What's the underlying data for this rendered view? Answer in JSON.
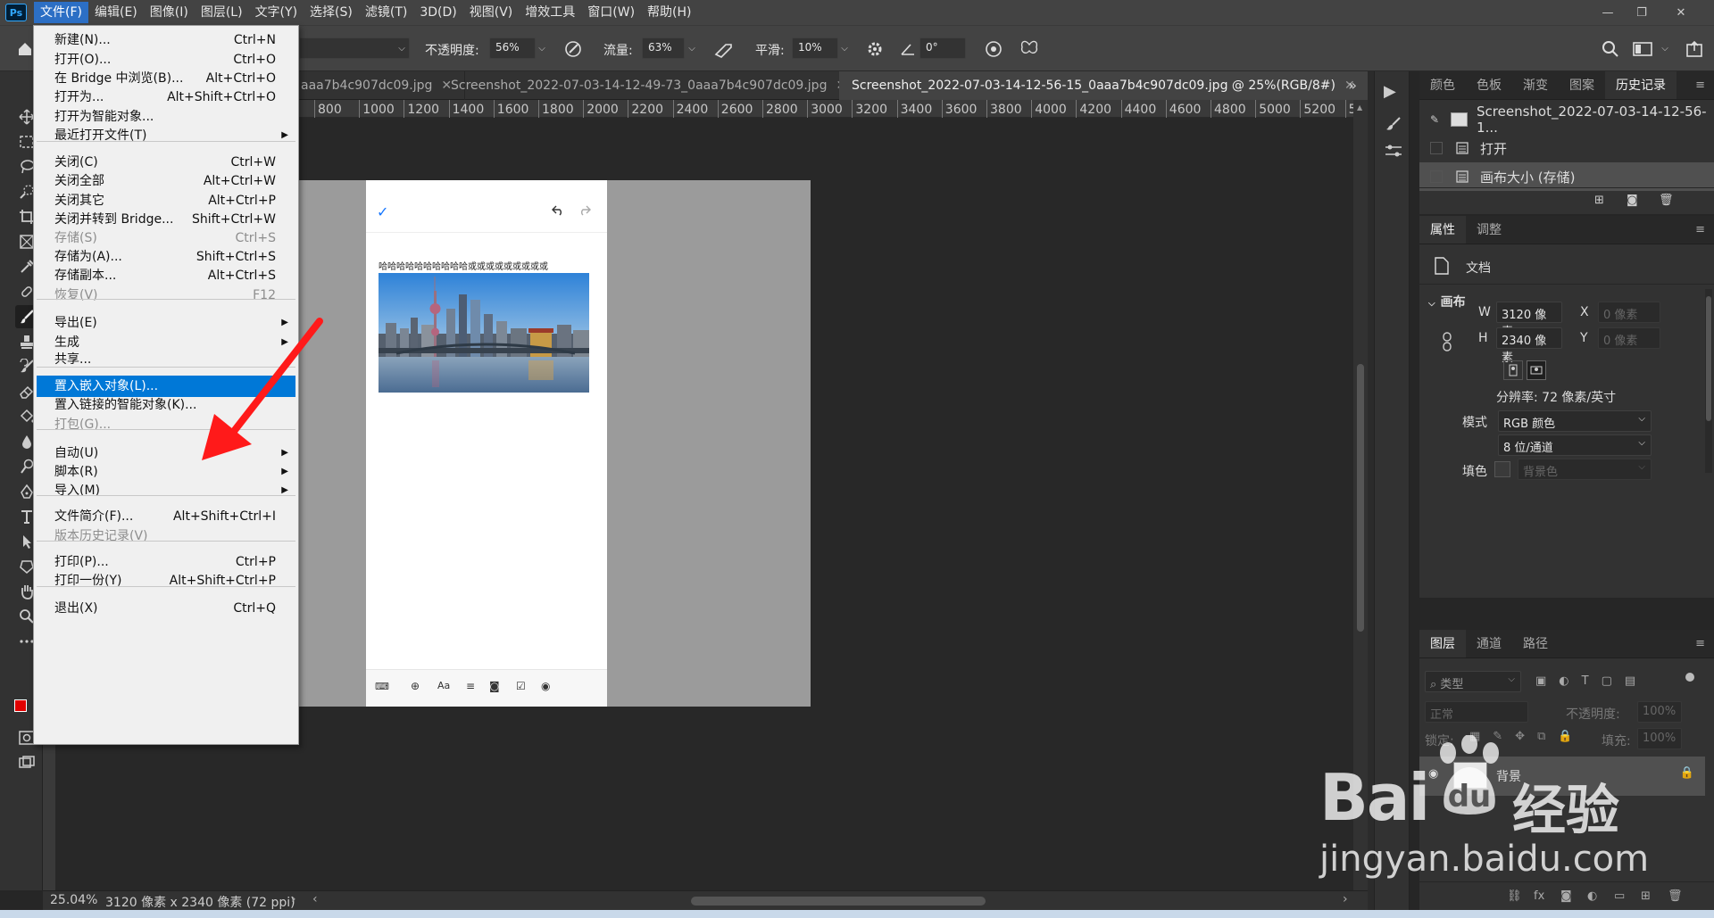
{
  "app": {
    "logo": "Ps"
  },
  "menubar": [
    "文件(F)",
    "编辑(E)",
    "图像(I)",
    "图层(L)",
    "文字(Y)",
    "选择(S)",
    "滤镜(T)",
    "3D(D)",
    "视图(V)",
    "增效工具",
    "窗口(W)",
    "帮助(H)"
  ],
  "options": {
    "opacity_label": "不透明度:",
    "opacity_value": "56%",
    "flow_label": "流量:",
    "flow_value": "63%",
    "smooth_label": "平滑:",
    "smooth_value": "10%",
    "angle_value": "0°"
  },
  "tabs": [
    {
      "label": "aaa7b4c907dc09.jpg",
      "active": false
    },
    {
      "label": "Screenshot_2022-07-03-14-12-49-73_0aaa7b4c907dc09.jpg",
      "active": false
    },
    {
      "label": "Screenshot_2022-07-03-14-12-56-15_0aaa7b4c907dc09.jpg @ 25%(RGB/8#)",
      "active": true
    }
  ],
  "ruler_h": [
    "800",
    "1000",
    "1200",
    "1400",
    "1600",
    "1800",
    "2000",
    "2200",
    "2400",
    "2600",
    "2800",
    "3000",
    "3200",
    "3400",
    "3600",
    "3800",
    "4000",
    "4200",
    "4400",
    "4600",
    "4800",
    "5000",
    "5200",
    "5"
  ],
  "canvas": {
    "note_text": "哈哈哈哈哈哈哈哈哈哈或或或或或或或或或"
  },
  "status": {
    "zoom": "25.04%",
    "doc_info": "3120 像素 x 2340 像素 (72 ppi)"
  },
  "file_menu": [
    {
      "label": "新建(N)...",
      "shortcut": "Ctrl+N"
    },
    {
      "label": "打开(O)...",
      "shortcut": "Ctrl+O"
    },
    {
      "label": "在 Bridge 中浏览(B)...",
      "shortcut": "Alt+Ctrl+O"
    },
    {
      "label": "打开为...",
      "shortcut": "Alt+Shift+Ctrl+O"
    },
    {
      "label": "打开为智能对象...",
      "shortcut": ""
    },
    {
      "label": "最近打开文件(T)",
      "shortcut": "",
      "submenu": true
    },
    {
      "label": "关闭(C)",
      "shortcut": "Ctrl+W"
    },
    {
      "label": "关闭全部",
      "shortcut": "Alt+Ctrl+W"
    },
    {
      "label": "关闭其它",
      "shortcut": "Alt+Ctrl+P"
    },
    {
      "label": "关闭并转到 Bridge...",
      "shortcut": "Shift+Ctrl+W"
    },
    {
      "label": "存储(S)",
      "shortcut": "Ctrl+S",
      "disabled": true
    },
    {
      "label": "存储为(A)...",
      "shortcut": "Shift+Ctrl+S"
    },
    {
      "label": "存储副本...",
      "shortcut": "Alt+Ctrl+S"
    },
    {
      "label": "恢复(V)",
      "shortcut": "F12",
      "disabled": true
    },
    {
      "label": "导出(E)",
      "shortcut": "",
      "submenu": true
    },
    {
      "label": "生成",
      "shortcut": "",
      "submenu": true
    },
    {
      "label": "共享...",
      "shortcut": ""
    },
    {
      "label": "置入嵌入对象(L)...",
      "shortcut": "",
      "highlighted": true
    },
    {
      "label": "置入链接的智能对象(K)...",
      "shortcut": ""
    },
    {
      "label": "打包(G)...",
      "shortcut": "",
      "disabled": true
    },
    {
      "label": "自动(U)",
      "shortcut": "",
      "submenu": true
    },
    {
      "label": "脚本(R)",
      "shortcut": "",
      "submenu": true
    },
    {
      "label": "导入(M)",
      "shortcut": "",
      "submenu": true
    },
    {
      "label": "文件简介(F)...",
      "shortcut": "Alt+Shift+Ctrl+I"
    },
    {
      "label": "版本历史记录(V)",
      "shortcut": "",
      "disabled": true
    },
    {
      "label": "打印(P)...",
      "shortcut": "Ctrl+P"
    },
    {
      "label": "打印一份(Y)",
      "shortcut": "Alt+Shift+Ctrl+P"
    },
    {
      "label": "退出(X)",
      "shortcut": "Ctrl+Q"
    }
  ],
  "history_panel": {
    "tabs": [
      "颜色",
      "色板",
      "渐变",
      "图案",
      "历史记录"
    ],
    "snapshot": "Screenshot_2022-07-03-14-12-56-1...",
    "items": [
      "打开",
      "画布大小 (存储)"
    ]
  },
  "properties_panel": {
    "tabs": [
      "属性",
      "调整"
    ],
    "doc_label": "文档",
    "section": "画布",
    "w_label": "W",
    "w_value": "3120 像素",
    "h_label": "H",
    "h_value": "2340 像素",
    "x_label": "X",
    "x_placeholder": "0 像素",
    "y_label": "Y",
    "y_placeholder": "0 像素",
    "resolution": "分辨率: 72 像素/英寸",
    "mode_label": "模式",
    "mode_value": "RGB 颜色",
    "depth_value": "8 位/通道",
    "fill_label": "填色",
    "fill_value": "背景色"
  },
  "layers_panel": {
    "tabs": [
      "图层",
      "通道",
      "路径"
    ],
    "filter_label": "类型",
    "blend_mode": "正常",
    "opacity_label": "不透明度:",
    "opacity_value": "100%",
    "lock_label": "锁定:",
    "fill_label": "填充:",
    "fill_value": "100%",
    "layer_name": "背景"
  },
  "watermark": {
    "brand": "Bai",
    "brand2": "经验",
    "url": "jingyan.baidu.com"
  },
  "colors": {
    "accent": "#0078d7",
    "foreground": "#e00000",
    "arrow": "#ff1a1a"
  }
}
